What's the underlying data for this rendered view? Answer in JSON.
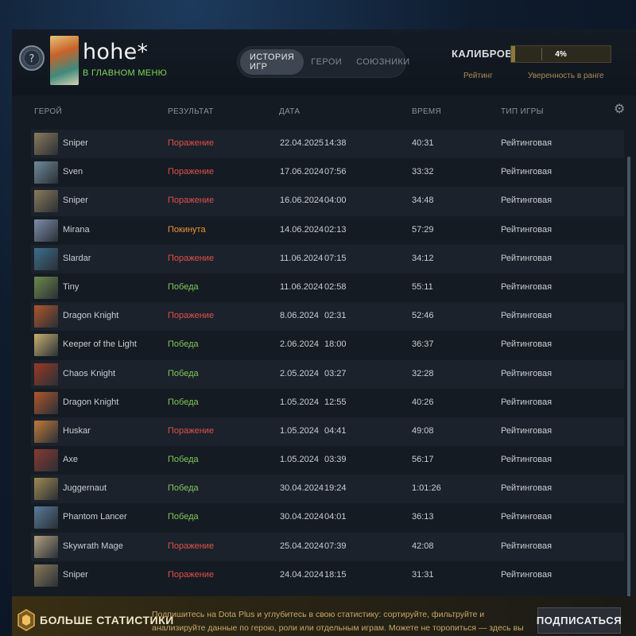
{
  "profile": {
    "username": "hohe*",
    "status": "В ГЛАВНОМ МЕНЮ"
  },
  "tabs": [
    {
      "label": "ИСТОРИЯ ИГР",
      "active": true
    },
    {
      "label": "ГЕРОИ",
      "active": false
    },
    {
      "label": "СОЮЗНИКИ",
      "active": false
    }
  ],
  "calibration": {
    "label": "КАЛИБРОВКА",
    "percent": "4%",
    "progress": 0.04,
    "rating_label": "Рейтинг",
    "confidence_label": "Уверенность в ранге"
  },
  "table": {
    "headers": {
      "hero": "ГЕРОЙ",
      "result": "РЕЗУЛЬТАТ",
      "date": "ДАТА",
      "duration": "ВРЕМЯ",
      "game_type": "ТИП ИГРЫ"
    },
    "rows": [
      {
        "hero": "Sniper",
        "result": "Поражение",
        "outcome": "loss",
        "date": "22.04.2025",
        "time": "14:38",
        "duration": "40:31",
        "game_type": "Рейтинговая",
        "color": "#8a7a5a"
      },
      {
        "hero": "Sven",
        "result": "Поражение",
        "outcome": "loss",
        "date": "17.06.2024",
        "time": "07:56",
        "duration": "33:32",
        "game_type": "Рейтинговая",
        "color": "#6f8a9a"
      },
      {
        "hero": "Sniper",
        "result": "Поражение",
        "outcome": "loss",
        "date": "16.06.2024",
        "time": "04:00",
        "duration": "34:48",
        "game_type": "Рейтинговая",
        "color": "#8a7a5a"
      },
      {
        "hero": "Mirana",
        "result": "Покинута",
        "outcome": "left",
        "date": "14.06.2024",
        "time": "02:13",
        "duration": "57:29",
        "game_type": "Рейтинговая",
        "color": "#7c8eaa"
      },
      {
        "hero": "Slardar",
        "result": "Поражение",
        "outcome": "loss",
        "date": "11.06.2024",
        "time": "07:15",
        "duration": "34:12",
        "game_type": "Рейтинговая",
        "color": "#3d6e8c"
      },
      {
        "hero": "Tiny",
        "result": "Победа",
        "outcome": "win",
        "date": "11.06.2024",
        "time": "02:58",
        "duration": "55:11",
        "game_type": "Рейтинговая",
        "color": "#6c8a4a"
      },
      {
        "hero": "Dragon Knight",
        "result": "Поражение",
        "outcome": "loss",
        "date": "8.06.2024",
        "time": "02:31",
        "duration": "52:46",
        "game_type": "Рейтинговая",
        "color": "#b0562c"
      },
      {
        "hero": "Keeper of the Light",
        "result": "Победа",
        "outcome": "win",
        "date": "2.06.2024",
        "time": "18:00",
        "duration": "36:37",
        "game_type": "Рейтинговая",
        "color": "#c8b070"
      },
      {
        "hero": "Chaos Knight",
        "result": "Победа",
        "outcome": "win",
        "date": "2.05.2024",
        "time": "03:27",
        "duration": "32:28",
        "game_type": "Рейтинговая",
        "color": "#9a3a24"
      },
      {
        "hero": "Dragon Knight",
        "result": "Победа",
        "outcome": "win",
        "date": "1.05.2024",
        "time": "12:55",
        "duration": "40:26",
        "game_type": "Рейтинговая",
        "color": "#b0562c"
      },
      {
        "hero": "Huskar",
        "result": "Поражение",
        "outcome": "loss",
        "date": "1.05.2024",
        "time": "04:41",
        "duration": "49:08",
        "game_type": "Рейтинговая",
        "color": "#c07a3a"
      },
      {
        "hero": "Axe",
        "result": "Победа",
        "outcome": "win",
        "date": "1.05.2024",
        "time": "03:39",
        "duration": "56:17",
        "game_type": "Рейтинговая",
        "color": "#8a3a30"
      },
      {
        "hero": "Juggernaut",
        "result": "Победа",
        "outcome": "win",
        "date": "30.04.2024",
        "time": "19:24",
        "duration": "1:01:26",
        "game_type": "Рейтинговая",
        "color": "#a08a50"
      },
      {
        "hero": "Phantom Lancer",
        "result": "Победа",
        "outcome": "win",
        "date": "30.04.2024",
        "time": "04:01",
        "duration": "36:13",
        "game_type": "Рейтинговая",
        "color": "#5a7a9a"
      },
      {
        "hero": "Skywrath Mage",
        "result": "Поражение",
        "outcome": "loss",
        "date": "25.04.2024",
        "time": "07:39",
        "duration": "42:08",
        "game_type": "Рейтинговая",
        "color": "#b0a080"
      },
      {
        "hero": "Sniper",
        "result": "Поражение",
        "outcome": "loss",
        "date": "24.04.2024",
        "time": "18:15",
        "duration": "31:31",
        "game_type": "Рейтинговая",
        "color": "#8a7a5a"
      }
    ]
  },
  "promo": {
    "title": "БОЛЬШЕ СТАТИСТИКИ",
    "text": "Подпишитесь на Dota Plus и углубитесь в свою статистику: сортируйте, фильтруйте и анализируйте данные по герою, роли или отдельным играм. Можете не торопиться — здесь вы найдёте всё.",
    "button": "ПОДПИСАТЬСЯ"
  },
  "icons": {
    "rank": "rank-medal-icon",
    "settings": "gear-icon",
    "promo": "dota-plus-icon"
  }
}
